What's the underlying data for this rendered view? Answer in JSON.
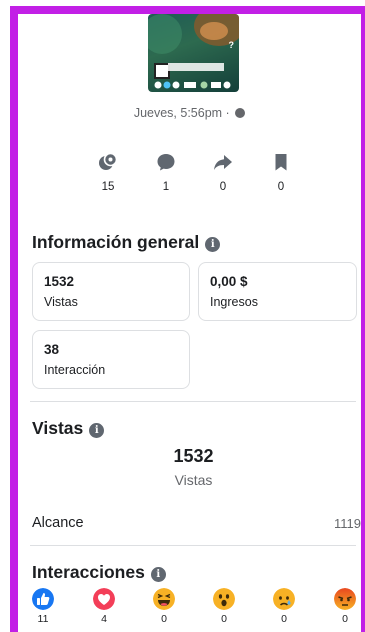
{
  "post": {
    "date_label": "Jueves, 5:56pm ·"
  },
  "actions": [
    {
      "icon": "reactions-icon",
      "count": "15"
    },
    {
      "icon": "comment-icon",
      "count": "1"
    },
    {
      "icon": "share-icon",
      "count": "0"
    },
    {
      "icon": "bookmark-icon",
      "count": "0"
    }
  ],
  "overview": {
    "title": "Información general",
    "cards": [
      {
        "value": "1532",
        "label": "Vistas"
      },
      {
        "value": "0,00 $",
        "label": "Ingresos"
      },
      {
        "value": "38",
        "label": "Interacción"
      }
    ]
  },
  "views": {
    "title": "Vistas",
    "total": "1532",
    "total_label": "Vistas",
    "reach_label": "Alcance",
    "reach_value": "1119"
  },
  "interactions": {
    "title": "Interacciones",
    "reactions": [
      {
        "icon": "like-icon",
        "count": "11",
        "color": "#1877f2"
      },
      {
        "icon": "love-icon",
        "count": "4",
        "color": "#f33e58"
      },
      {
        "icon": "haha-icon",
        "count": "0",
        "color": "#f7b125"
      },
      {
        "icon": "wow-icon",
        "count": "0",
        "color": "#f7b125"
      },
      {
        "icon": "sad-icon",
        "count": "0",
        "color": "#f7b125"
      },
      {
        "icon": "angry-icon",
        "count": "0",
        "color": "#e9710f"
      }
    ]
  },
  "colors": {
    "frame": "#c21fe6",
    "text": "#1c1e21",
    "muted": "#65676b",
    "border": "#dddfe2"
  }
}
